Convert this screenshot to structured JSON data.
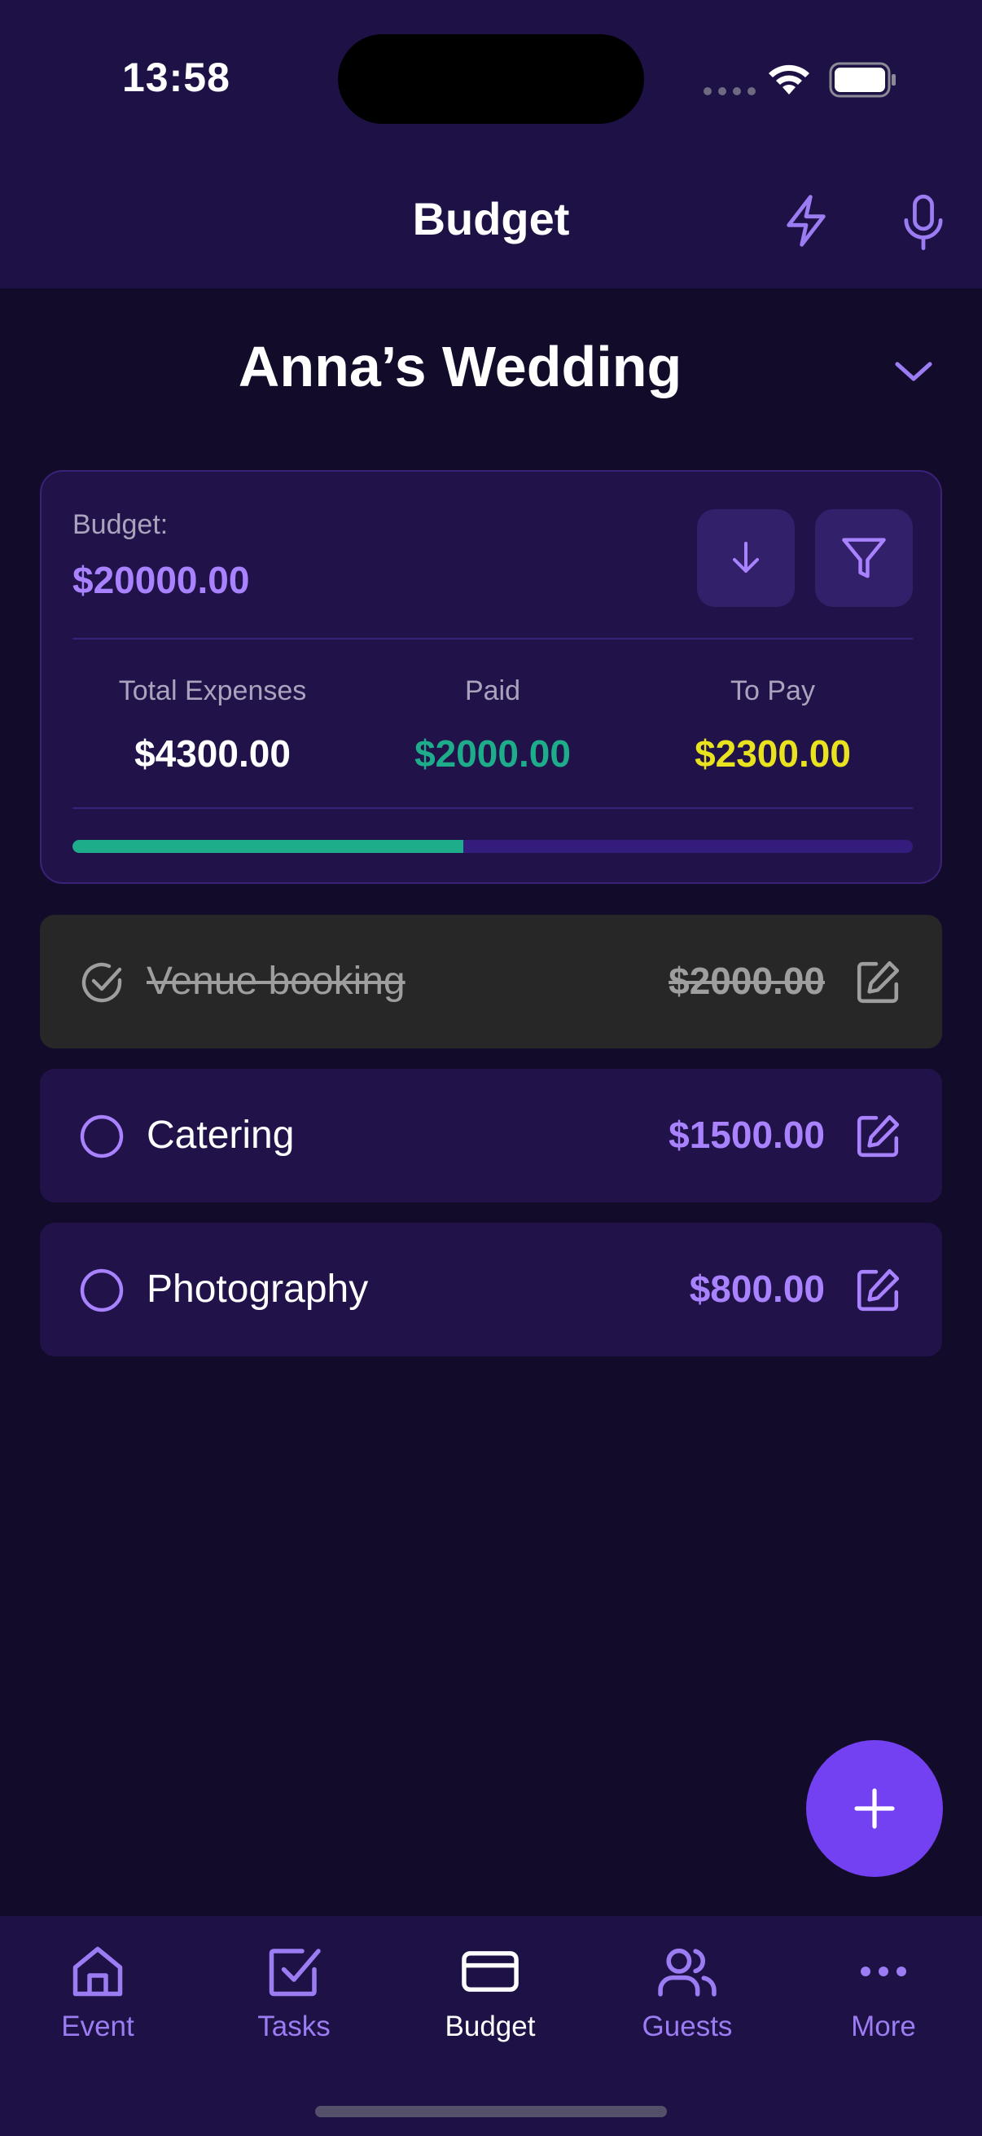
{
  "status_bar": {
    "time": "13:58"
  },
  "header": {
    "title": "Budget",
    "icons": [
      "lightning-icon",
      "microphone-icon"
    ]
  },
  "event": {
    "name": "Anna’s Wedding"
  },
  "budget_card": {
    "budget_label": "Budget:",
    "budget_amount": "$20000.00",
    "total_expenses_label": "Total Expenses",
    "total_expenses_value": "$4300.00",
    "paid_label": "Paid",
    "paid_value": "$2000.00",
    "to_pay_label": "To Pay",
    "to_pay_value": "$2300.00",
    "paid_progress_fraction": 0.465,
    "colors": {
      "paid": "#1ead8a",
      "to_pay": "#e8e31e",
      "accent": "#a983ff"
    }
  },
  "expenses": [
    {
      "name": "Venue booking",
      "amount": "$2000.00",
      "paid": true
    },
    {
      "name": "Catering",
      "amount": "$1500.00",
      "paid": false
    },
    {
      "name": "Photography",
      "amount": "$800.00",
      "paid": false
    }
  ],
  "bottom_nav": {
    "items": [
      {
        "label": "Event",
        "icon": "home-icon",
        "active": false
      },
      {
        "label": "Tasks",
        "icon": "checkbox-icon",
        "active": false
      },
      {
        "label": "Budget",
        "icon": "card-icon",
        "active": true
      },
      {
        "label": "Guests",
        "icon": "users-icon",
        "active": false
      },
      {
        "label": "More",
        "icon": "more-icon",
        "active": false
      }
    ]
  },
  "fab": {
    "icon": "plus-icon"
  }
}
